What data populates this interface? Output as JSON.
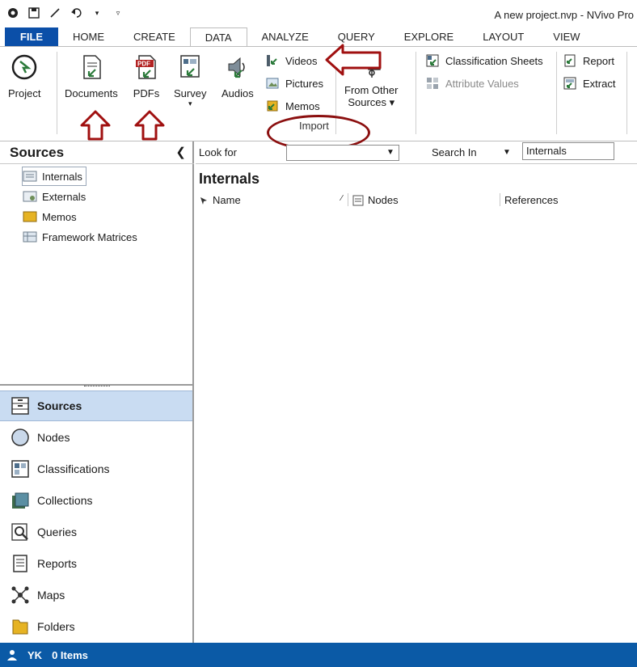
{
  "window": {
    "title": "A new project.nvp - NVivo Pro"
  },
  "qat": {
    "icons": [
      "nvivo-logo-icon",
      "save-icon",
      "edit-icon",
      "undo-icon",
      "dropdown-icon",
      "customize-icon"
    ]
  },
  "ribbon_tabs": [
    {
      "label": "FILE"
    },
    {
      "label": "HOME"
    },
    {
      "label": "CREATE"
    },
    {
      "label": "DATA"
    },
    {
      "label": "ANALYZE"
    },
    {
      "label": "QUERY"
    },
    {
      "label": "EXPLORE"
    },
    {
      "label": "LAYOUT"
    },
    {
      "label": "VIEW"
    }
  ],
  "ribbon": {
    "project": "Project",
    "documents": "Documents",
    "pdfs": "PDFs",
    "survey": "Survey",
    "audios": "Audios",
    "videos": "Videos",
    "pictures": "Pictures",
    "memos": "Memos",
    "from_other_line1": "From Other",
    "from_other_line2": "Sources ▾",
    "group_import": "Import",
    "classification_sheets": "Classification Sheets",
    "attribute_values": "Attribute Values",
    "report": "Report",
    "extract": "Extract"
  },
  "sources_pane": {
    "title": "Sources",
    "items": [
      {
        "label": "Internals"
      },
      {
        "label": "Externals"
      },
      {
        "label": "Memos"
      },
      {
        "label": "Framework Matrices"
      }
    ]
  },
  "nav": [
    {
      "label": "Sources"
    },
    {
      "label": "Nodes"
    },
    {
      "label": "Classifications"
    },
    {
      "label": "Collections"
    },
    {
      "label": "Queries"
    },
    {
      "label": "Reports"
    },
    {
      "label": "Maps"
    },
    {
      "label": "Folders"
    }
  ],
  "find_bar": {
    "look_for": "Look for",
    "search_in": "Search In",
    "search_in_value": "Internals"
  },
  "list": {
    "title": "Internals",
    "columns": [
      "Name",
      "Nodes",
      "References"
    ]
  },
  "status": {
    "user": "YK",
    "items": "0 Items"
  },
  "colors": {
    "accent_blue": "#0b4fa8",
    "status_blue": "#0b5aa6",
    "annotation_red": "#a01010",
    "nav_active": "#c9dcf2"
  }
}
